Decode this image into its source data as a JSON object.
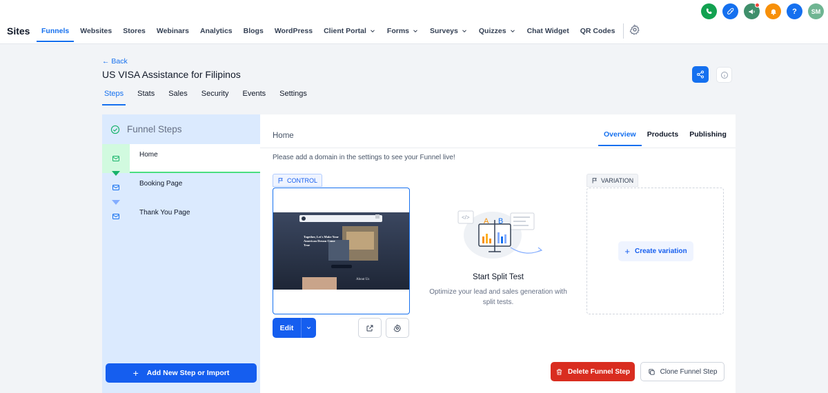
{
  "brand": "Sites",
  "nav": {
    "items": [
      {
        "label": "Funnels",
        "active": true,
        "dropdown": false
      },
      {
        "label": "Websites",
        "dropdown": false
      },
      {
        "label": "Stores",
        "dropdown": false
      },
      {
        "label": "Webinars",
        "dropdown": false
      },
      {
        "label": "Analytics",
        "dropdown": false
      },
      {
        "label": "Blogs",
        "dropdown": false
      },
      {
        "label": "WordPress",
        "dropdown": false
      },
      {
        "label": "Client Portal",
        "dropdown": true
      },
      {
        "label": "Forms",
        "dropdown": true
      },
      {
        "label": "Surveys",
        "dropdown": true
      },
      {
        "label": "Quizzes",
        "dropdown": true
      },
      {
        "label": "Chat Widget",
        "dropdown": false
      },
      {
        "label": "QR Codes",
        "dropdown": false
      }
    ],
    "settings_icon": "gear-icon"
  },
  "top_icons": [
    {
      "name": "phone-icon",
      "color": "#12a150"
    },
    {
      "name": "rocket-icon",
      "color": "#1570ef"
    },
    {
      "name": "megaphone-icon",
      "color": "#3f8f6b"
    },
    {
      "name": "bell-icon",
      "color": "#f79009"
    },
    {
      "name": "help-icon",
      "color": "#1570ef",
      "text": "?"
    },
    {
      "name": "avatar",
      "color": "#6fb592",
      "text": "SM"
    }
  ],
  "header": {
    "back_label": "← Back",
    "title": "US VISA Assistance for Filipinos"
  },
  "subtabs": [
    "Steps",
    "Stats",
    "Sales",
    "Security",
    "Events",
    "Settings"
  ],
  "left_panel": {
    "heading": "Funnel Steps",
    "steps": [
      "Home",
      "Booking Page",
      "Thank You Page"
    ],
    "add_button": "Add New Step or Import"
  },
  "main": {
    "title": "Home",
    "tabs": [
      "Overview",
      "Products",
      "Publishing"
    ],
    "notice": "Please add a domain in the settings to see your Funnel live!",
    "control_tag": "CONTROL",
    "variation_tag": "VARIATION",
    "edit_label": "Edit",
    "split_title": "Start Split Test",
    "split_sub": "Optimize your lead and sales generation with split tests.",
    "create_variation": "Create variation",
    "delete_label": "Delete Funnel Step",
    "clone_label": "Clone Funnel Step",
    "preview": {
      "headline": "Together, Let's Make Your American Dream Come True",
      "about": "About Us"
    },
    "illustration": {
      "a": "A",
      "b": "B"
    }
  },
  "colors": {
    "accent": "#155eef",
    "danger": "#d92d20",
    "panel_bg": "#dbeafe",
    "step_active_border": "#4ade80"
  }
}
